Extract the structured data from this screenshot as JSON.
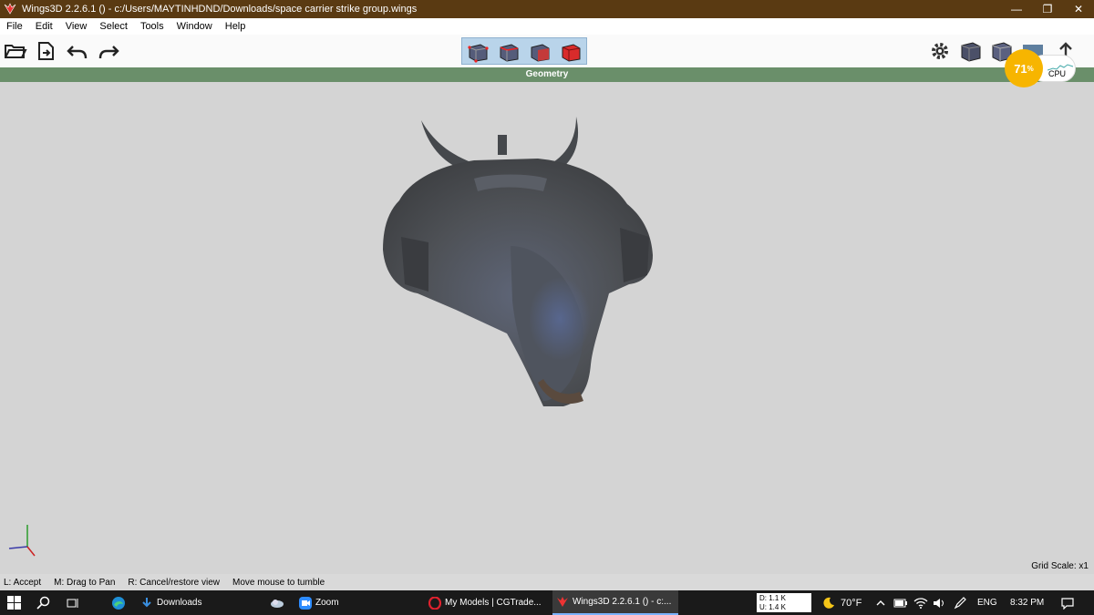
{
  "window": {
    "title": "Wings3D 2.2.6.1 () - c:/Users/MAYTINHDND/Downloads/space carrier strike group.wings",
    "minimize_glyph": "—",
    "restore_glyph": "❐",
    "close_glyph": "✕"
  },
  "menu": [
    "File",
    "Edit",
    "View",
    "Select",
    "Tools",
    "Window",
    "Help"
  ],
  "toolbar": {
    "icons": [
      "open-folder-icon",
      "import-icon",
      "undo-icon",
      "redo-icon"
    ],
    "select_modes": [
      "vertex-mode",
      "edge-mode",
      "face-mode",
      "body-mode"
    ],
    "right_icons": [
      "settings-gear-icon",
      "smooth-shaded-cube-icon",
      "flat-cube-icon",
      "screen-icon",
      "export-arrow-icon"
    ]
  },
  "header": {
    "label": "Geometry"
  },
  "cpu": {
    "percent": "71",
    "percent_sign": "%",
    "label": "CPU"
  },
  "viewport": {
    "grid_scale": "Grid Scale: x1"
  },
  "status": {
    "items": [
      "L: Accept",
      "M: Drag to Pan",
      "R: Cancel/restore view",
      "Move mouse to tumble"
    ]
  },
  "taskbar": {
    "apps": [
      {
        "label": "Downloads"
      },
      {
        "label": "Zoom"
      },
      {
        "label": "My Models | CGTrade..."
      },
      {
        "label": "Wings3D 2.2.6.1 () - c:..."
      }
    ],
    "net_down": "D: 1.1 K",
    "net_up": "U: 1.4 K",
    "weather": "70°F",
    "lang": "ENG",
    "time": "8:32 PM"
  },
  "colors": {
    "titlebar": "#5a3a12",
    "geometry_header": "#6a8f6a",
    "viewport": "#d4d4d4",
    "cpu_accent": "#f7b500",
    "body_mode": "#d92b2b"
  }
}
